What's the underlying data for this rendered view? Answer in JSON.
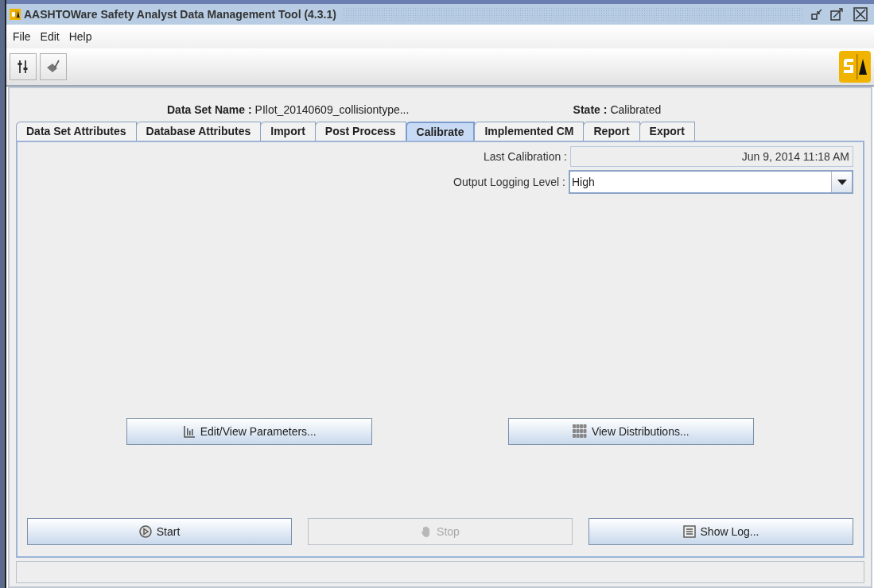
{
  "window": {
    "title": "AASHTOWare Safety Analyst Data Management Tool (4.3.1)"
  },
  "menu": [
    "File",
    "Edit",
    "Help"
  ],
  "header": {
    "data_set_label": "Data Set Name :",
    "data_set_value": "PIlot_20140609_collisiontype...",
    "state_label": "State :",
    "state_value": "Calibrated"
  },
  "tabs": [
    {
      "label": "Data Set Attributes",
      "selected": false
    },
    {
      "label": "Database Attributes",
      "selected": false
    },
    {
      "label": "Import",
      "selected": false
    },
    {
      "label": "Post Process",
      "selected": false
    },
    {
      "label": "Calibrate",
      "selected": true
    },
    {
      "label": "Implemented CM",
      "selected": false
    },
    {
      "label": "Report",
      "selected": false
    },
    {
      "label": "Export",
      "selected": false
    }
  ],
  "last_calibration": {
    "label": "Last Calibration :",
    "value": "Jun 9, 2014 11:18 AM"
  },
  "logging": {
    "label": "Output Logging Level :",
    "value": "High"
  },
  "middle_buttons": [
    {
      "label": "Edit/View Parameters...",
      "kind": "chart"
    },
    {
      "label": "View Distributions...",
      "kind": "grid"
    }
  ],
  "bottom_buttons": [
    {
      "label": "Start",
      "kind": "play",
      "disabled": false
    },
    {
      "label": "Stop",
      "kind": "hand",
      "disabled": true
    },
    {
      "label": "Show Log...",
      "kind": "log",
      "disabled": false
    }
  ]
}
